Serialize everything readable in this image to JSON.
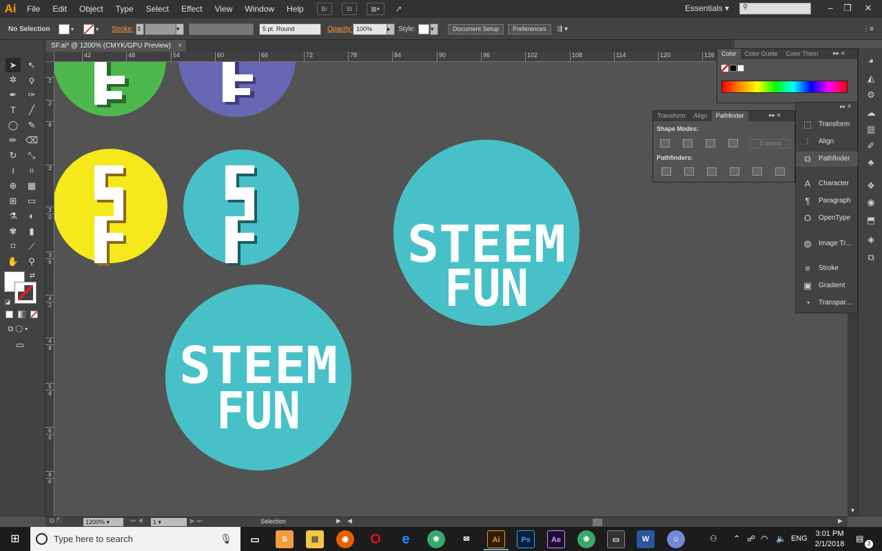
{
  "app": {
    "logo": "Ai",
    "workspace": "Essentials",
    "search_placeholder": ""
  },
  "menu": [
    "File",
    "Edit",
    "Object",
    "Type",
    "Select",
    "Effect",
    "View",
    "Window",
    "Help"
  ],
  "menubar_icons": {
    "bridge": "Br",
    "stock": "St"
  },
  "control": {
    "selection": "No Selection",
    "stroke_label": "Stroke:",
    "brush": "5 pt. Round",
    "opacity_label": "Opacity:",
    "opacity": "100%",
    "style_label": "Style:",
    "doc_setup": "Document Setup",
    "preferences": "Preferences"
  },
  "document": {
    "tab": "SF.ai* @ 1200% (CMYK/GPU Preview)",
    "close": "×"
  },
  "ruler_h": [
    "42",
    "48",
    "54",
    "60",
    "66",
    "72",
    "78",
    "84",
    "90",
    "96",
    "102",
    "108",
    "114",
    "120",
    "126"
  ],
  "ruler_v": [
    "2",
    "2",
    "8",
    "3",
    "3",
    "0",
    "3",
    "6",
    "4",
    "2",
    "4",
    "8",
    "5",
    "4",
    "6",
    "0",
    "6",
    "6"
  ],
  "artwork": {
    "colors": {
      "green": "#4db84d",
      "purple": "#6767b3",
      "yellow": "#f5e91c",
      "teal": "#47c1c7",
      "white": "#ffffff"
    },
    "logo_line1": "STEEM",
    "logo_line2": "FUN"
  },
  "status": {
    "zoom": "1200%",
    "page": "1",
    "tool": "Selection"
  },
  "color_panel": {
    "tabs": [
      "Color",
      "Color Guide",
      "Color Them"
    ]
  },
  "pathfinder_panel": {
    "tabs": [
      "Transform",
      "Align",
      "Pathfinder"
    ],
    "shape_modes": "Shape Modes:",
    "pathfinders": "Pathfinders:",
    "expand": "Expand"
  },
  "dock": [
    "Transform",
    "Align",
    "Pathfinder",
    "Character",
    "Paragraph",
    "OpenType",
    "Image Tr...",
    "Stroke",
    "Gradient",
    "Transpar..."
  ],
  "taskbar": {
    "search": "Type here to search",
    "language": "ENG",
    "time": "3:01 PM",
    "date": "2/1/2018",
    "notifications": "3"
  }
}
